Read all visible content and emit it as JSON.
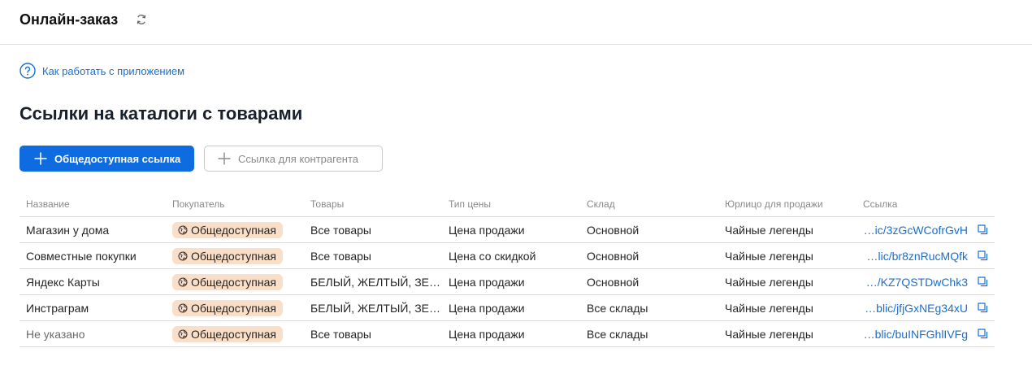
{
  "header": {
    "title": "Онлайн-заказ"
  },
  "help": {
    "label": "Как работать с приложением"
  },
  "page_title": "Ссылки на каталоги с товарами",
  "buttons": {
    "public_link": "Общедоступная ссылка",
    "counterparty_link": "Ссылка для контрагента"
  },
  "colors": {
    "accent": "#0e6be0",
    "link": "#1a6fd0",
    "badge_bg": "#fadfc8"
  },
  "table": {
    "columns": [
      "Название",
      "Покупатель",
      "Товары",
      "Тип цены",
      "Склад",
      "Юрлицо для продажи",
      "Ссылка"
    ],
    "rows": [
      {
        "name": "Магазин у дома",
        "buyer": "Общедоступная",
        "goods": "Все товары",
        "price_type": "Цена продажи",
        "warehouse": "Основной",
        "legal_entity": "Чайные легенды",
        "link": "…ic/3zGcWCofrGvH"
      },
      {
        "name": "Совместные покупки",
        "buyer": "Общедоступная",
        "goods": "Все товары",
        "price_type": "Цена со скидкой",
        "warehouse": "Основной",
        "legal_entity": "Чайные легенды",
        "link": "…lic/br8znRucMQfk"
      },
      {
        "name": "Яндекс Карты",
        "buyer": "Общедоступная",
        "goods": "БЕЛЫЙ, ЖЕЛТЫЙ, ЗЕ…",
        "price_type": "Цена продажи",
        "warehouse": "Основной",
        "legal_entity": "Чайные легенды",
        "link": "…/KZ7QSTDwChk3"
      },
      {
        "name": "Инстраграм",
        "buyer": "Общедоступная",
        "goods": "БЕЛЫЙ, ЖЕЛТЫЙ, ЗЕ…",
        "price_type": "Цена продажи",
        "warehouse": "Все склады",
        "legal_entity": "Чайные легенды",
        "link": "…blic/jfjGxNEg34xU"
      },
      {
        "name": "Не указано",
        "buyer": "Общедоступная",
        "goods": "Все товары",
        "price_type": "Цена продажи",
        "warehouse": "Все склады",
        "legal_entity": "Чайные легенды",
        "link": "…blic/buINFGhlIVFg"
      }
    ]
  }
}
